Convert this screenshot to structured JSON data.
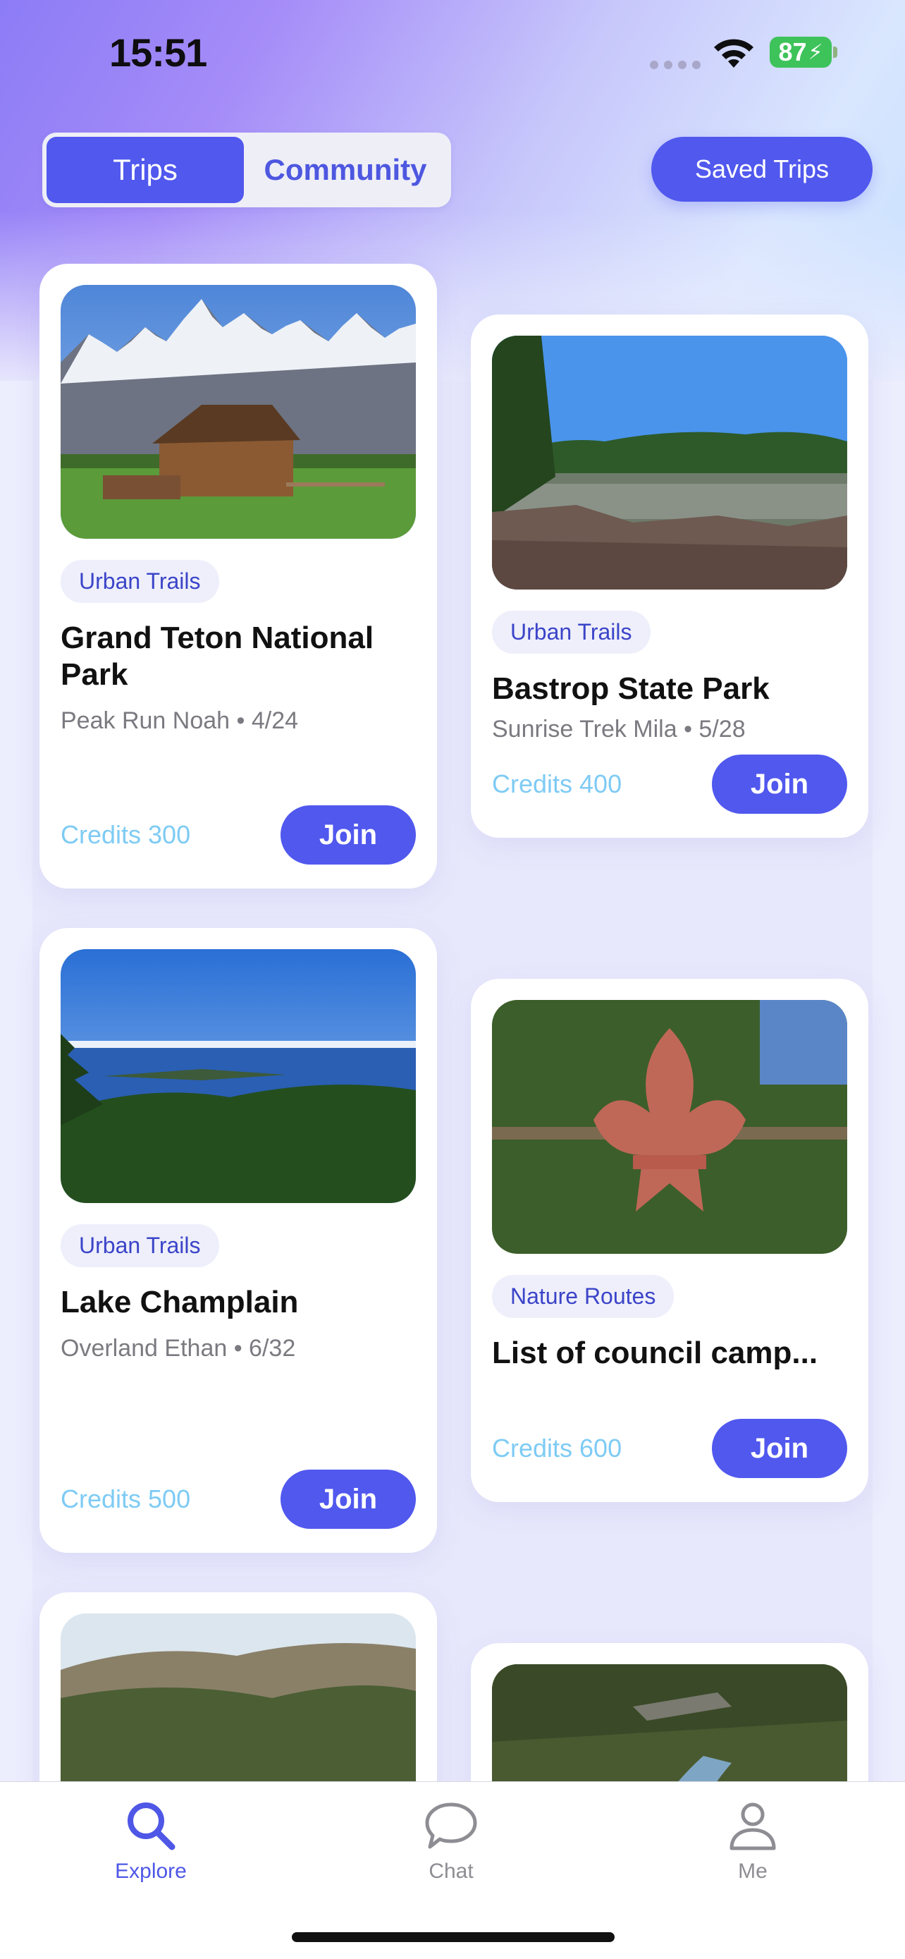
{
  "status_bar": {
    "time": "15:51",
    "battery": "87"
  },
  "header": {
    "tabs": [
      {
        "label": "Trips",
        "active": true
      },
      {
        "label": "Community",
        "active": false
      }
    ],
    "saved_trips_label": "Saved Trips"
  },
  "cards": [
    {
      "tag": "Urban Trails",
      "title": "Grand Teton National Park",
      "meta": "Peak Run Noah • 4/24",
      "credits": "Credits 300",
      "join": "Join"
    },
    {
      "tag": "Urban Trails",
      "title": "Bastrop State Park",
      "meta": "Sunrise Trek Mila • 5/28",
      "credits": "Credits 400",
      "join": "Join"
    },
    {
      "tag": "Urban Trails",
      "title": "Lake Champlain",
      "meta": "Overland Ethan • 6/32",
      "credits": "Credits 500",
      "join": "Join"
    },
    {
      "tag": "Nature Routes",
      "title": "List of council camp...",
      "meta": "",
      "credits": "Credits 600",
      "join": "Join"
    }
  ],
  "tabbar": {
    "items": [
      {
        "label": "Explore",
        "icon": "search-icon",
        "active": true
      },
      {
        "label": "Chat",
        "icon": "chat-bubble-icon",
        "active": false
      },
      {
        "label": "Me",
        "icon": "person-icon",
        "active": false
      }
    ]
  },
  "colors": {
    "accent": "#5158EE",
    "credits": "#7ECBF4",
    "tag_text": "#3B44C8"
  }
}
